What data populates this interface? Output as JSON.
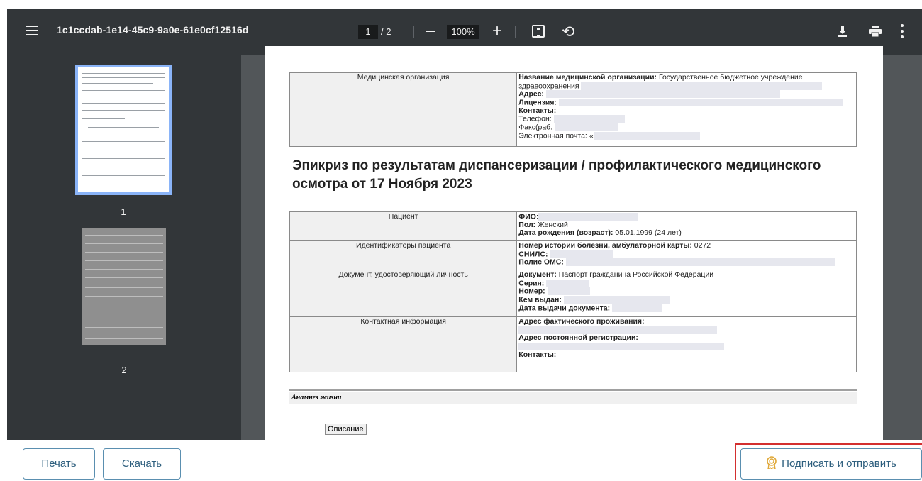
{
  "viewer": {
    "title": "1c1ccdab-1e14-45c9-9a0e-61e0cf12516d",
    "page_current": "1",
    "page_total": "/ 2",
    "zoom": "100%"
  },
  "thumbnails": [
    {
      "label": "1",
      "selected": true
    },
    {
      "label": "2",
      "selected": false
    }
  ],
  "document": {
    "org_table": {
      "key": "Медицинская организация",
      "name_label": "Название медицинской организации:",
      "name_value": " Государственное бюджетное учреждение",
      "name_value2": "здравоохранения",
      "address_label": "Адрес:",
      "license_label": "Лицензия:",
      "contacts_label": "Контакты:",
      "phone_label": "Телефон:",
      "fax_label": "Факс(раб.",
      "email_label": "Электронная почта: «"
    },
    "heading": "Эпикриз по результатам диспансеризации / профилактического медицинского осмотра от 17 Ноября 2023",
    "patient_table": {
      "patient_key": "Пациент",
      "fio_label": "ФИО:",
      "sex_label": "Пол:",
      "sex_value": " Женский",
      "dob_label": "Дата рождения (возраст):",
      "dob_value": " 05.01.1999 (24 лет)",
      "ids_key": "Идентификаторы пациента",
      "history_label": "Номер истории болезни, амбулаторной карты:",
      "history_value": " 0272",
      "snils_label": "СНИЛС:",
      "oms_label": "Полис ОМС:",
      "doc_key": "Документ, удостоверяющий личность",
      "doc_label": "Документ:",
      "doc_value": " Паспорт гражданина Российской Федерации",
      "series_label": "Серия:",
      "number_label": "Номер:",
      "issued_label": "Кем выдан:",
      "issue_date_label": "Дата выдачи документа:",
      "contact_key": "Контактная информация",
      "actual_addr_label": "Адрес фактического проживания:",
      "reg_addr_label": "Адрес постоянной регистрации:",
      "contacts_label": "Контакты:"
    },
    "anamnesis_title": "Анамнез жизни",
    "description_label": "Описание"
  },
  "buttons": {
    "print": "Печать",
    "download": "Скачать",
    "sign_send": "Подписать и отправить"
  },
  "colors": {
    "toolbar_bg": "#323639",
    "viewer_bg": "#525659",
    "thumb_selected": "#8ab4f8",
    "button_border": "#5a8fb0",
    "highlight": "#d32f2f",
    "cert_icon": "#e0a93a"
  }
}
